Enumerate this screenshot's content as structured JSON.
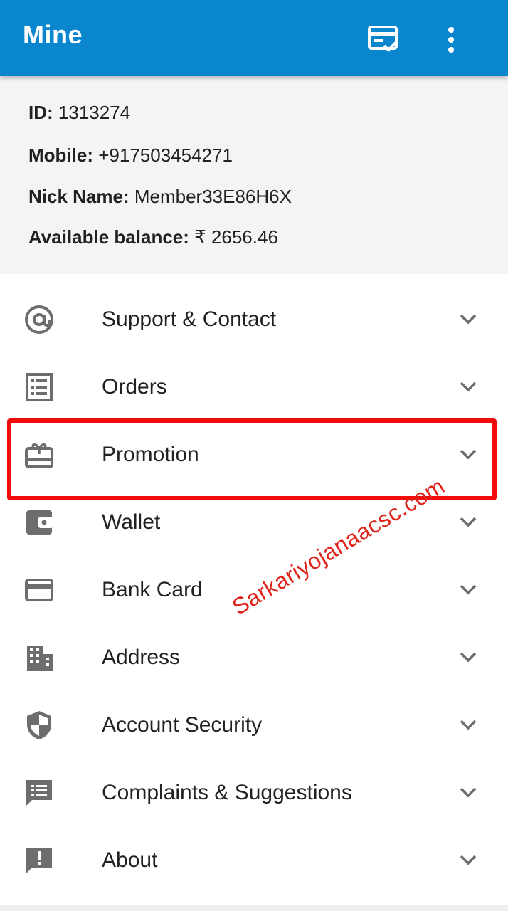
{
  "appbar": {
    "title": "Mine",
    "actions": [
      {
        "icon": "checklist-card-icon"
      },
      {
        "icon": "more-vert-icon"
      }
    ]
  },
  "profile": {
    "id_label": "ID:",
    "id_value": "1313274",
    "mobile_label": "Mobile:",
    "mobile_value": "+917503454271",
    "nick_label": "Nick Name:",
    "nick_value": "Member33E86H6X",
    "balance_label": "Available balance:",
    "balance_value": "₹ 2656.46"
  },
  "menu": {
    "items": [
      {
        "label": "Support & Contact",
        "icon": "at-sign-icon"
      },
      {
        "label": "Orders",
        "icon": "list-icon"
      },
      {
        "label": "Promotion",
        "icon": "gift-card-icon",
        "highlighted": true
      },
      {
        "label": "Wallet",
        "icon": "wallet-icon"
      },
      {
        "label": "Bank Card",
        "icon": "credit-card-icon"
      },
      {
        "label": "Address",
        "icon": "building-icon"
      },
      {
        "label": "Account Security",
        "icon": "shield-icon"
      },
      {
        "label": "Complaints & Suggestions",
        "icon": "feedback-icon"
      },
      {
        "label": "About",
        "icon": "info-alert-icon"
      }
    ]
  },
  "colors": {
    "appbar": "#0a86cf",
    "highlight_border": "#f20b0b",
    "icon": "#6d6d6d",
    "watermark": "#e0221a"
  },
  "watermark": "Sarkariyojanaacsc.com"
}
